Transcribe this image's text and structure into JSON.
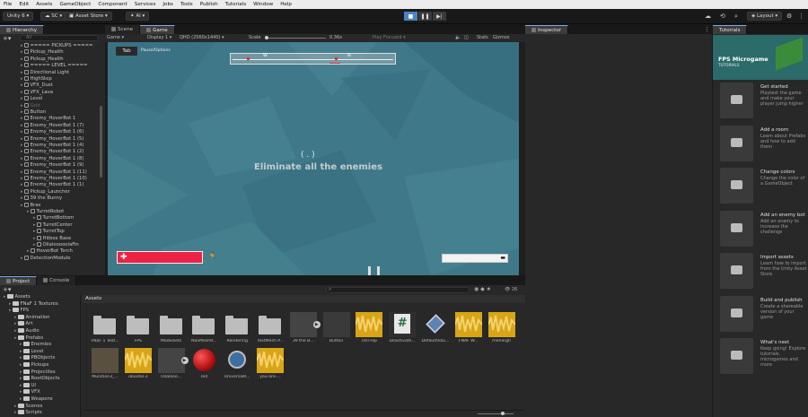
{
  "menu": [
    "File",
    "Edit",
    "Assets",
    "GameObject",
    "Component",
    "Services",
    "Jobs",
    "Tools",
    "Publish",
    "Tutorials",
    "Window",
    "Help"
  ],
  "toolbar": {
    "account": "Unity 6",
    "sc": "SC",
    "store": "Asset Store",
    "ai": "AI",
    "layout": "Layout"
  },
  "scene_tab": "Scene",
  "game_tab": "Game",
  "game_toolbar": {
    "mode": "Game",
    "display": "Display 1",
    "resolution": "QHD (2560x1440)",
    "scale_label": "Scale",
    "scale_value": "0.36x",
    "play_focused": "Play Focused",
    "stats": "Stats",
    "gizmos": "Gizmos"
  },
  "hud": {
    "tab_label": "Tab",
    "pause_label": "Pause/Options",
    "compass": [
      "W",
      "N"
    ],
    "crosshair": "(  .  )",
    "objective": "Eliminate all the enemies"
  },
  "inspector_tab": "Inspector",
  "hierarchy": {
    "tab": "Hierarchy",
    "search_placeholder": "All",
    "items": [
      "===== PICKUPS =====",
      "Pickup_Health",
      "Pickup_Health",
      "===== LEVEL =====",
      "Directional Light",
      "HighStep",
      "VFX_Dust",
      "VFX_Lava",
      "Level",
      "Grid",
      "Button",
      "Enemy_HoverBot 1",
      "Enemy_HoverBot 1 (7)",
      "Enemy_HoverBot 1 (6)",
      "Enemy_HoverBot 1 (5)",
      "Enemy_HoverBot 1 (4)",
      "Enemy_HoverBot 1 (2)",
      "Enemy_HoverBot 1 (8)",
      "Enemy_HoverBot 1 (9)",
      "Enemy_HoverBot 1 (11)",
      "Enemy_HoverBot 1 (10)",
      "Enemy_HoverBot 1 (1)",
      "Pickup_Launcher",
      "39 the Bunny",
      "Bras",
      "TurretRobot",
      "TurretBottom",
      "TurretCenter",
      "TurretTop",
      "Hitbox Base",
      "OilalooooolaFin",
      "HoverBot Torch",
      "DetectionModule"
    ]
  },
  "project": {
    "tab": "Project",
    "console_tab": "Console",
    "assets_header": "Assets",
    "count": "26",
    "tree": [
      "Assets",
      "FNaF 1 Textures",
      "FPS",
      "Animation",
      "Art",
      "Audio",
      "Prefabs",
      "Enemies",
      "Level",
      "PBObjects",
      "Pickups",
      "Projectiles",
      "RootObjects",
      "UI",
      "VFX",
      "Weapons",
      "Scenes",
      "Scripts"
    ],
    "assets_row1": [
      "FNaF 1 Text...",
      "FPS",
      "Modelsets",
      "NavMeshR...",
      "Rendering",
      "TextMesh P...",
      "39 the B...",
      "Button",
      "cell-rep",
      "Deactivate...",
      "DefaultVolu...",
      "FNAF W...",
      "menergh"
    ],
    "assets_row2": [
      "Munition3_...",
      "obiodal-3",
      "Oilalooo...",
      "red",
      "UniversalR...",
      "you-are-..."
    ]
  },
  "tutorials": {
    "tab": "Tutorials",
    "header_title": "FPS Microgame",
    "header_sub": "TUTORIALS",
    "cards": [
      {
        "title": "Get started",
        "desc": "Playtest the game and make your player jump higher"
      },
      {
        "title": "Add a room",
        "desc": "Learn about Prefabs and how to add them"
      },
      {
        "title": "Change colors",
        "desc": "Change the color of a GameObject"
      },
      {
        "title": "Add an enemy bot",
        "desc": "Add an enemy to increase the challenge"
      },
      {
        "title": "Import assets",
        "desc": "Learn how to import from the Unity Asset Store"
      },
      {
        "title": "Build and publish",
        "desc": "Create a shareable version of your game"
      },
      {
        "title": "What's next",
        "desc": "Keep going! Explore tutorials, microgames and more"
      }
    ]
  }
}
